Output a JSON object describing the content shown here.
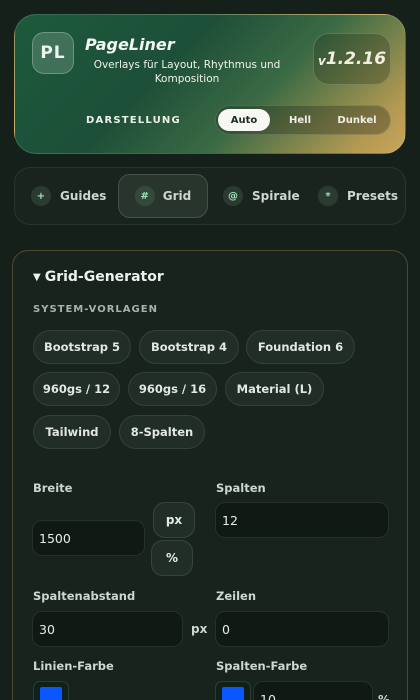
{
  "header": {
    "logo": "PL",
    "title": "PageLiner",
    "subtitle": "Overlays für Layout, Rhythmus und Komposition",
    "version_prefix": "v",
    "version_number": "1.2.16",
    "theme_label": "DARSTELLUNG",
    "theme_options": [
      "Auto",
      "Hell",
      "Dunkel"
    ],
    "theme_selected": "Auto"
  },
  "tabs": [
    {
      "icon": "+",
      "label": "Guides"
    },
    {
      "icon": "#",
      "label": "Grid"
    },
    {
      "icon": "@",
      "label": "Spirale"
    },
    {
      "icon": "*",
      "label": "Presets"
    }
  ],
  "active_tab": "Grid",
  "panel": {
    "title": "Grid-Generator",
    "presets_label": "SYSTEM-VORLAGEN",
    "presets": [
      "Bootstrap 5",
      "Bootstrap 4",
      "Foundation 6",
      "960gs / 12",
      "960gs / 16",
      "Material (L)",
      "Tailwind",
      "8-Spalten"
    ],
    "width_label": "Breite",
    "width_value": "1500",
    "unit_px": "px",
    "unit_percent": "%",
    "columns_label": "Spalten",
    "columns_value": "12",
    "gutter_label": "Spaltenabstand",
    "gutter_value": "30",
    "gutter_unit": "px",
    "rows_label": "Zeilen",
    "rows_value": "0",
    "line_color_label": "Linien-Farbe",
    "column_color_label": "Spalten-Farbe",
    "line_color": "#0a57ff",
    "column_color": "#0a57ff",
    "opacity_value": "10",
    "opacity_unit": "%"
  }
}
